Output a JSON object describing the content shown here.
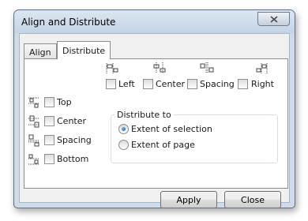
{
  "window": {
    "title": "Align and Distribute",
    "close_icon": "close-icon"
  },
  "tabs": [
    {
      "label": "Align",
      "active": false
    },
    {
      "label": "Distribute",
      "active": true
    }
  ],
  "horizontal": {
    "items": [
      {
        "label": "Left",
        "icon": "distribute-left-icon",
        "checked": false
      },
      {
        "label": "Center",
        "icon": "distribute-center-h-icon",
        "checked": false
      },
      {
        "label": "Spacing",
        "icon": "distribute-spacing-h-icon",
        "checked": false
      },
      {
        "label": "Right",
        "icon": "distribute-right-icon",
        "checked": false
      }
    ]
  },
  "vertical": {
    "items": [
      {
        "label": "Top",
        "icon": "distribute-top-icon",
        "checked": false
      },
      {
        "label": "Center",
        "icon": "distribute-center-v-icon",
        "checked": false
      },
      {
        "label": "Spacing",
        "icon": "distribute-spacing-v-icon",
        "checked": false
      },
      {
        "label": "Bottom",
        "icon": "distribute-bottom-icon",
        "checked": false
      }
    ]
  },
  "distribute_to": {
    "legend": "Distribute to",
    "options": [
      {
        "label": "Extent of selection",
        "selected": true
      },
      {
        "label": "Extent of page",
        "selected": false
      }
    ]
  },
  "buttons": {
    "apply": "Apply",
    "close": "Close"
  },
  "colors": {
    "frame": "#cfdbe8",
    "radio_selected": "#1b5fa8"
  }
}
